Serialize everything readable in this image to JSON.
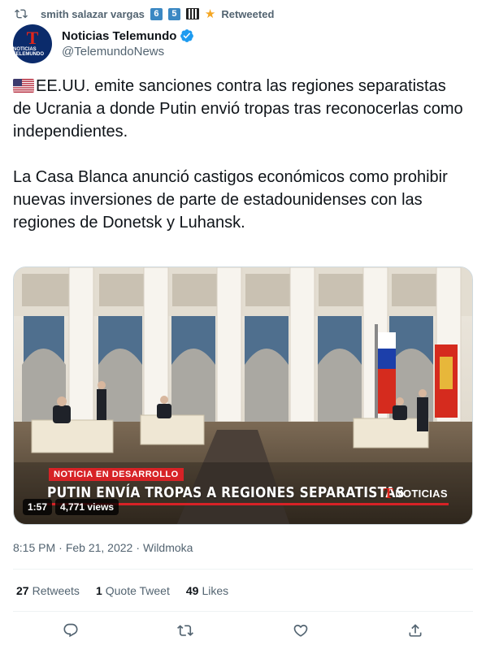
{
  "retweet": {
    "user": "smith salazar vargas",
    "badges": [
      "6",
      "5"
    ],
    "label": "Retweeted"
  },
  "author": {
    "avatar_text": "NOTICIAS TELEMUNDO",
    "avatar_logo": "T",
    "name": "Noticias Telemundo",
    "handle": "@TelemundoNews"
  },
  "tweet": {
    "text_line1": "EE.UU. emite sanciones contra las regiones separatistas de Ucrania a donde Putin envió tropas tras reconocerlas como independientes.",
    "text_line2": "La Casa Blanca anunció castigos económicos como prohibir nuevas inversiones de parte de estadounidenses con las regiones de Donetsk y Luhansk."
  },
  "video": {
    "tag": "NOTICIA EN DESARROLLO",
    "headline": "PUTIN ENVÍA TROPAS A REGIONES SEPARATISTAS",
    "brand": "NOTICIAS",
    "brand_logo": "T",
    "duration": "1:57",
    "views": "4,771 views"
  },
  "meta": {
    "time": "8:15 PM",
    "sep1": "·",
    "date": "Feb 21, 2022",
    "sep2": "·",
    "source": "Wildmoka"
  },
  "stats": {
    "retweets_count": "27",
    "retweets_label": "Retweets",
    "quotes_count": "1",
    "quotes_label": "Quote Tweet",
    "likes_count": "49",
    "likes_label": "Likes"
  },
  "icons": {
    "retweet": "retweet-icon",
    "verified": "verified-badge-icon",
    "reply": "reply-icon",
    "like": "heart-icon",
    "share": "share-icon"
  },
  "colors": {
    "accent": "#1d9bf0",
    "muted": "#536471",
    "news_red": "#d72226"
  }
}
